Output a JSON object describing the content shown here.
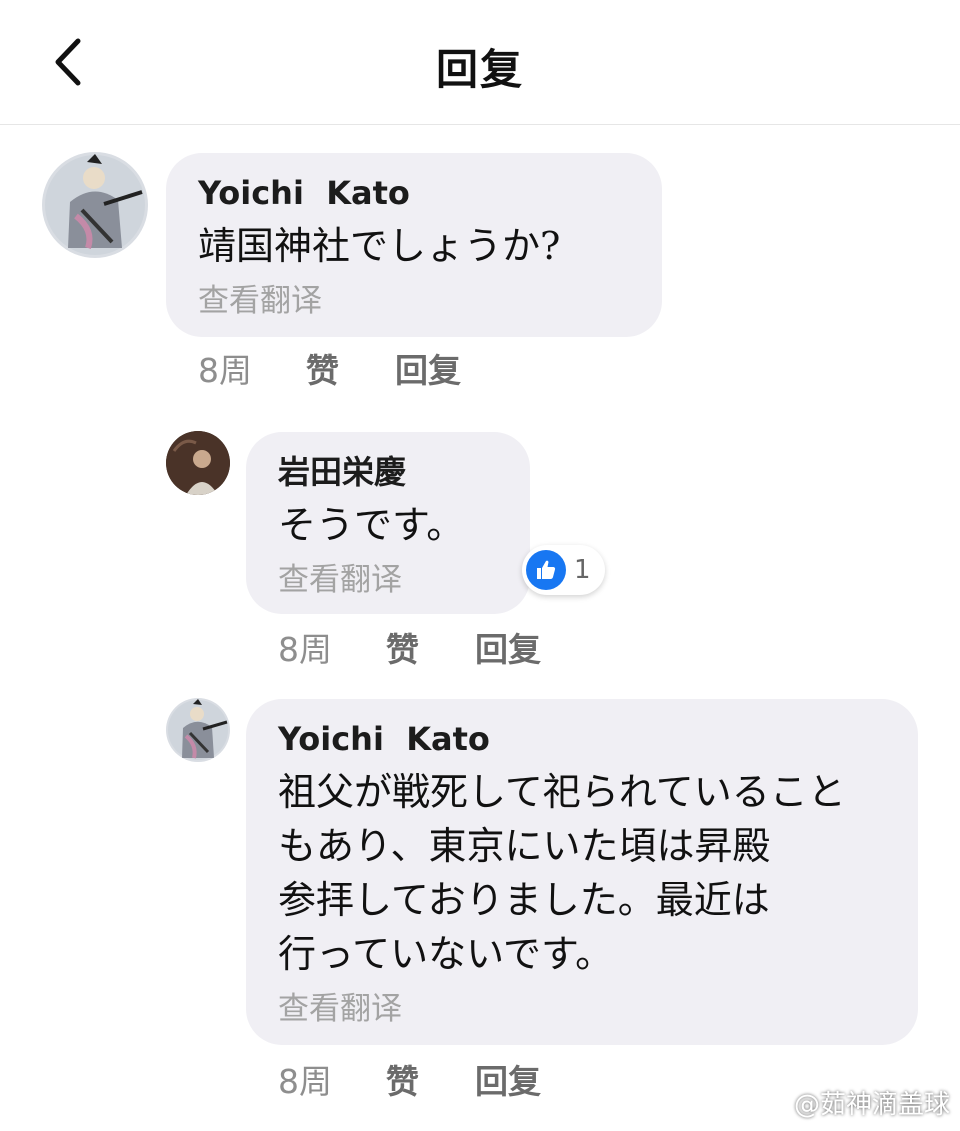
{
  "header": {
    "title": "回复",
    "back_icon": "chevron-left-icon"
  },
  "comments": [
    {
      "author": "Yoichi  Kato",
      "text": "靖国神社でしょうか?",
      "translate": "查看翻译",
      "time": "8周",
      "like": "赞",
      "reply": "回复"
    },
    {
      "author": "岩田栄慶",
      "text": "そうです。",
      "translate": "查看翻译",
      "time": "8周",
      "like": "赞",
      "reply": "回复",
      "reaction": {
        "icon": "thumbs-up-icon",
        "count": "1"
      }
    },
    {
      "author": "Yoichi  Kato",
      "text": "祖父が戦死して祀られていること\nもあり、東京にいた頃は昇殿\n参拝しておりました。最近は\n行っていないです。",
      "translate": "查看翻译",
      "time": "8周",
      "like": "赞",
      "reply": "回复"
    }
  ],
  "watermark": {
    "text": "@茹神滴盖球",
    "icon": "weibo-icon"
  },
  "colors": {
    "bubble": "#f0eff4",
    "like_blue": "#1877f2",
    "meta_gray": "#8e8e8e"
  }
}
